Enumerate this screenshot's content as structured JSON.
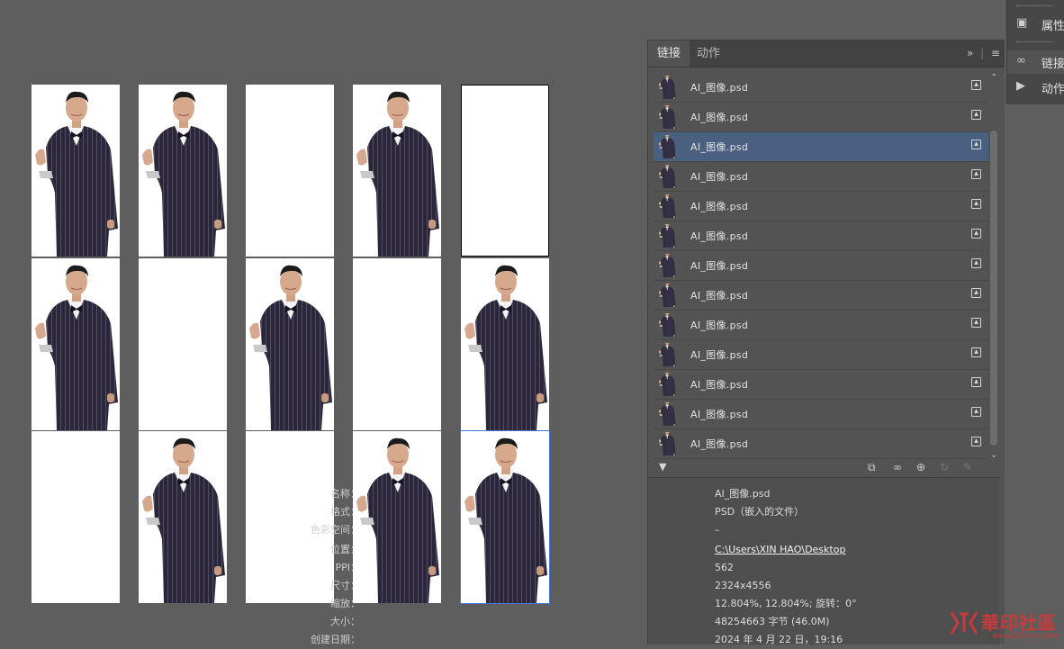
{
  "canvas": {
    "artboards": [
      {
        "has_photo": true
      },
      {
        "has_photo": true
      },
      {
        "has_photo": false
      },
      {
        "has_photo": true
      },
      {
        "has_photo": false
      },
      {
        "has_photo": true
      },
      {
        "has_photo": false
      },
      {
        "has_photo": true
      },
      {
        "has_photo": false
      },
      {
        "has_photo": true
      },
      {
        "has_photo": false
      },
      {
        "has_photo": true
      },
      {
        "has_photo": false
      },
      {
        "has_photo": true
      },
      {
        "has_photo": true
      }
    ]
  },
  "links_panel": {
    "tabs": [
      "链接",
      "动作"
    ],
    "active_tab": "链接",
    "menu_icons": [
      "expand-icon",
      "panel-menu-icon"
    ],
    "items": [
      {
        "name": "AI_图像.psd",
        "selected": false
      },
      {
        "name": "AI_图像.psd",
        "selected": false
      },
      {
        "name": "AI_图像.psd",
        "selected": true
      },
      {
        "name": "AI_图像.psd",
        "selected": false
      },
      {
        "name": "AI_图像.psd",
        "selected": false
      },
      {
        "name": "AI_图像.psd",
        "selected": false
      },
      {
        "name": "AI_图像.psd",
        "selected": false
      },
      {
        "name": "AI_图像.psd",
        "selected": false
      },
      {
        "name": "AI_图像.psd",
        "selected": false
      },
      {
        "name": "AI_图像.psd",
        "selected": false
      },
      {
        "name": "AI_图像.psd",
        "selected": false
      },
      {
        "name": "AI_图像.psd",
        "selected": false
      },
      {
        "name": "AI_图像.psd",
        "selected": false
      }
    ],
    "toolbar_icons": [
      "relink-cc-icon",
      "relink-icon",
      "goto-link-icon",
      "update-link-icon",
      "edit-original-icon"
    ],
    "info": {
      "name_label": "名称：",
      "name_value": "AI_图像.psd",
      "format_label": "格式：",
      "format_value": "PSD（嵌入的文件）",
      "colorspace_label": "色彩空间：",
      "colorspace_value": "–",
      "location_label": "位置：",
      "location_value": "C:\\Users\\XIN HAO\\Desktop",
      "ppi_label": "PPI：",
      "ppi_value": "562",
      "size_label": "尺寸：",
      "size_value": "2324x4556",
      "scale_label": "缩放：",
      "scale_value": "12.804%, 12.804%; 旋转：0°",
      "filesize_label": "大小：",
      "filesize_value": "48254663 字节 (46.0M)",
      "created_label": "创建日期：",
      "created_value": "2024 年 4 月 22 日，19:16"
    }
  },
  "dock": {
    "items": [
      {
        "label": "属性",
        "icon": "properties-icon"
      },
      {
        "label": "链接",
        "icon": "links-icon"
      },
      {
        "label": "动作",
        "icon": "play-icon"
      }
    ]
  },
  "watermark": {
    "text": "華印社區",
    "url": "www.52cnp.com"
  },
  "colors": {
    "selection": "#4a6080",
    "artboard_selected": "#4a74d8",
    "watermark": "#c63b3b"
  }
}
